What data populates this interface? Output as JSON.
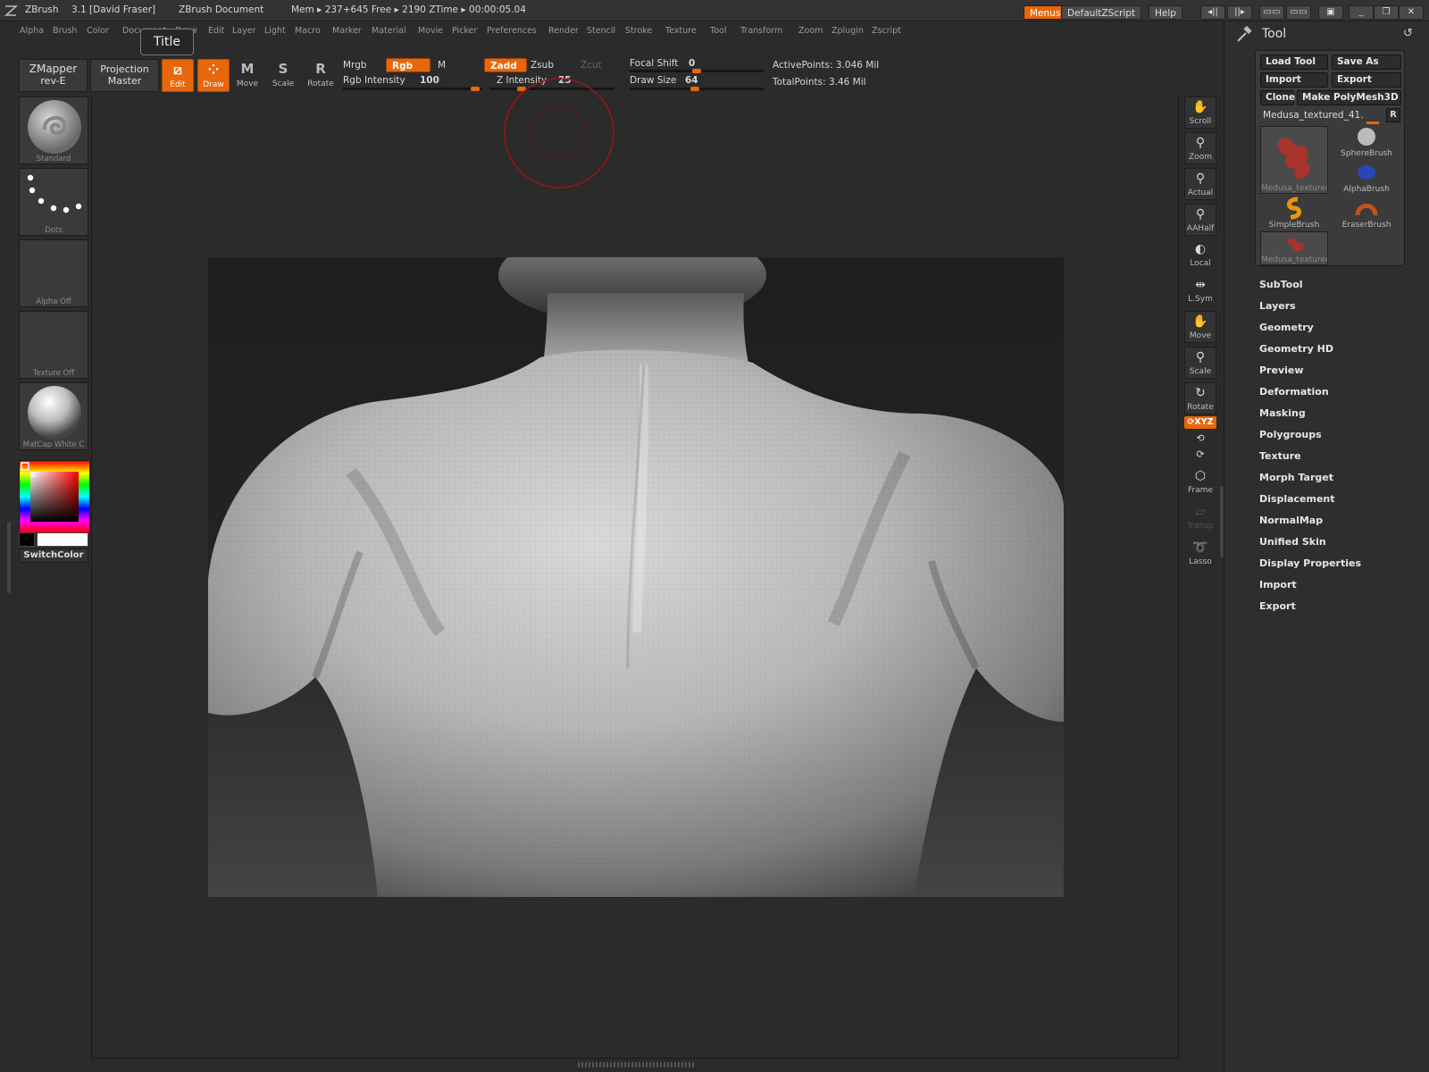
{
  "titlebar": {
    "app": "ZBrush",
    "version": "3.1 [David Fraser]",
    "document": "ZBrush Document",
    "mem": "Mem ▸ 237+645  Free ▸ 2190  ZTime ▸ 00:00:05.04",
    "menus_btn": "Menus",
    "script_btn": "DefaultZScript",
    "help_btn": "Help"
  },
  "menubar": {
    "items": [
      "Alpha",
      "Brush",
      "Color",
      "Document",
      "Draw",
      "Edit",
      "Layer",
      "Light",
      "Macro",
      "Marker",
      "Material",
      "Movie",
      "Picker",
      "Preferences",
      "Render",
      "Stencil",
      "Stroke",
      "Texture",
      "Tool",
      "Transform",
      "Zoom",
      "Zplugin",
      "Zscript"
    ],
    "tooltip": "Title"
  },
  "toolbar": {
    "zmapper_line1": "ZMapper",
    "zmapper_line2": "rev-E",
    "projection_line1": "Projection",
    "projection_line2": "Master",
    "edit": "Edit",
    "draw": "Draw",
    "move": "Move",
    "scale": "Scale",
    "rotate": "Rotate",
    "mrgb": "Mrgb",
    "rgb": "Rgb",
    "m": "M",
    "rgb_intensity_label": "Rgb Intensity",
    "rgb_intensity": "100",
    "zadd": "Zadd",
    "zsub": "Zsub",
    "zcut": "Zcut",
    "z_intensity_label": "Z Intensity",
    "z_intensity": "25",
    "focal_shift_label": "Focal Shift",
    "focal_shift": "0",
    "draw_size_label": "Draw Size",
    "draw_size": "64",
    "active_points": "ActivePoints: 3.046  Mil",
    "total_points": "TotalPoints: 3.46  Mil"
  },
  "leftshelf": {
    "brush": "Standard",
    "stroke": "Dots",
    "alpha": "Alpha  Off",
    "texture": "Texture  Off",
    "material": "MatCap  White  C",
    "switch_color": "SwitchColor"
  },
  "rightshelf": {
    "buttons": [
      "Scroll",
      "Zoom",
      "Actual",
      "AAHalf",
      "Local",
      "L.Sym",
      "Move",
      "Scale",
      "Rotate",
      "Frame",
      "Transp",
      "Lasso"
    ],
    "xyz": "⟳XYZ"
  },
  "toolpanel": {
    "title": "Tool",
    "load_tool": "Load Tool",
    "save_as": "Save As",
    "import": "Import",
    "export": "Export",
    "clone": "Clone",
    "make_polymesh": "Make PolyMesh3D",
    "current_tool": "Medusa_textured_41.",
    "r": "R",
    "tools": [
      "Medusa_textured",
      "SphereBrush",
      "AlphaBrush",
      "SimpleBrush",
      "EraserBrush",
      "Medusa_textured"
    ],
    "subpalettes": [
      "SubTool",
      "Layers",
      "Geometry",
      "Geometry HD",
      "Preview",
      "Deformation",
      "Masking",
      "Polygroups",
      "Texture",
      "Morph Target",
      "Displacement",
      "NormalMap",
      "Unified Skin",
      "Display Properties",
      "Import",
      "Export"
    ]
  },
  "colors": {
    "accent": "#e8660c",
    "panel": "#2e2e2e",
    "canvas": "#2b2b2b"
  }
}
